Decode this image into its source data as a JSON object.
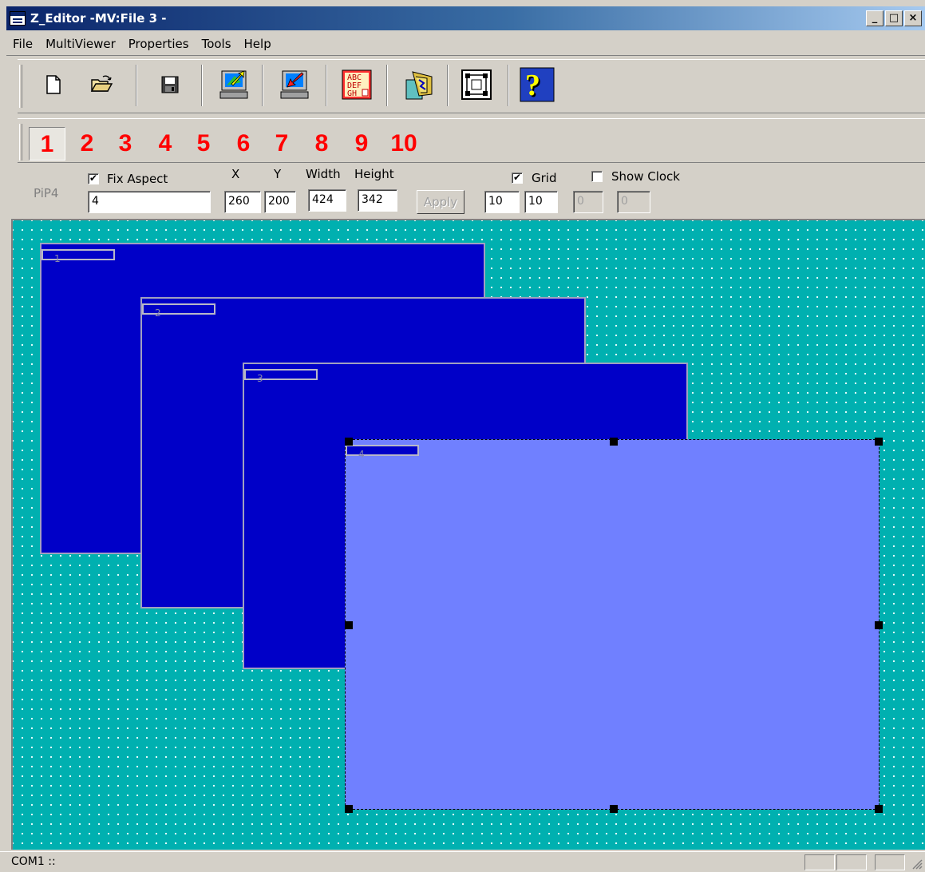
{
  "window": {
    "title": "Z_Editor -MV:File  3 -",
    "minimize": "_",
    "maximize": "□",
    "close": "×"
  },
  "menu": {
    "items": [
      "File",
      "MultiViewer",
      "Properties",
      "Tools",
      "Help"
    ]
  },
  "toolbar": {
    "buttons": [
      {
        "name": "new-file",
        "icon": "new-document-icon"
      },
      {
        "name": "open-file",
        "icon": "open-folder-icon"
      },
      {
        "name": "save-file",
        "icon": "floppy-disk-icon"
      },
      {
        "name": "send-to-device",
        "icon": "computer-upload-icon"
      },
      {
        "name": "receive-from-device",
        "icon": "computer-download-icon"
      },
      {
        "name": "labels",
        "icon": "abc-grid-icon"
      },
      {
        "name": "sequence",
        "icon": "layers-icon"
      },
      {
        "name": "layout",
        "icon": "layout-frame-icon"
      },
      {
        "name": "help",
        "icon": "question-icon"
      }
    ]
  },
  "pip_selector": {
    "numbers": [
      "1",
      "2",
      "3",
      "4",
      "5",
      "6",
      "7",
      "8",
      "9",
      "10"
    ],
    "active": "1"
  },
  "properties": {
    "pip_label": "PiP4",
    "fix_aspect_label": "Fix Aspect",
    "fix_aspect_checked": "✔",
    "name_value": "4",
    "x_label": "X",
    "y_label": "Y",
    "width_label": "Width",
    "height_label": "Height",
    "x_value": "260",
    "y_value": "200",
    "width_value": "424",
    "height_value": "342",
    "apply_label": "Apply",
    "grid_label": "Grid",
    "grid_checked": "✔",
    "grid_x": "10",
    "grid_y": "10",
    "show_clock_label": "Show Clock",
    "show_clock_checked": "",
    "clock_a": "0",
    "clock_b": "0"
  },
  "canvas": {
    "background_color": "#00b0b0",
    "pip_color": "#0000c8",
    "selected_color": "#7080ff",
    "pips": [
      {
        "label": "1",
        "selected": false
      },
      {
        "label": "2",
        "selected": false
      },
      {
        "label": "3",
        "selected": false
      },
      {
        "label": "4",
        "selected": true
      }
    ]
  },
  "status": {
    "text": "COM1  ::"
  }
}
